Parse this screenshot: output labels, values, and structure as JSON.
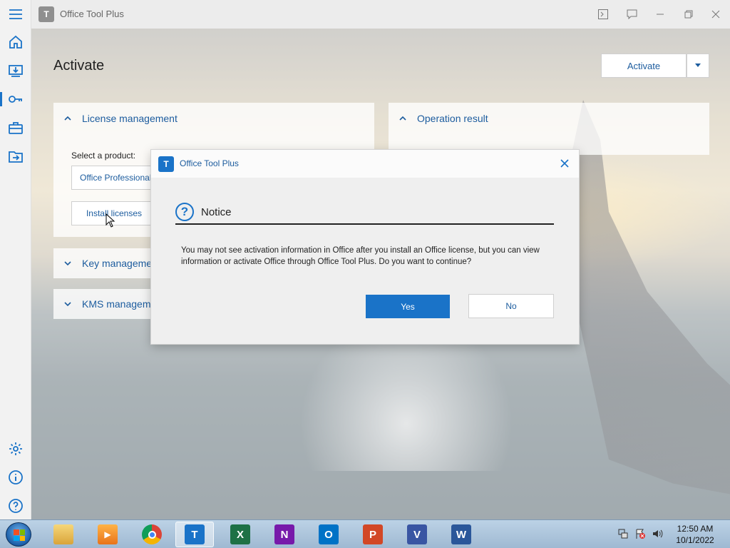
{
  "window": {
    "title": "Office Tool Plus"
  },
  "sidebar": {
    "items": [
      {
        "name": "home",
        "icon": "home-icon"
      },
      {
        "name": "deploy",
        "icon": "download-monitor-icon"
      },
      {
        "name": "activate",
        "icon": "key-icon",
        "active": true
      },
      {
        "name": "toolbox",
        "icon": "toolbox-icon"
      },
      {
        "name": "convert",
        "icon": "folder-arrow-icon"
      },
      {
        "name": "settings",
        "icon": "gear-icon"
      },
      {
        "name": "about",
        "icon": "info-icon"
      },
      {
        "name": "help",
        "icon": "help-icon"
      }
    ]
  },
  "page": {
    "title": "Activate",
    "activate_button": "Activate"
  },
  "cards": {
    "license": {
      "title": "License management",
      "select_label": "Select a product:",
      "select_value": "Office Professional",
      "install_button": "Install licenses"
    },
    "key": {
      "title": "Key manageme"
    },
    "kms": {
      "title": "KMS manageme"
    },
    "result": {
      "title": "Operation result"
    }
  },
  "dialog": {
    "title": "Office Tool Plus",
    "heading": "Notice",
    "message": "You may not see activation information in Office after you install an Office license, but you can view information or activate Office through Office Tool Plus. Do you want to continue?",
    "yes_label": "Yes",
    "no_label": "No"
  },
  "taskbar": {
    "apps": [
      {
        "name": "file-explorer",
        "letter": "",
        "color": "#e8b84a"
      },
      {
        "name": "media-player",
        "letter": "",
        "color": "#f08a24"
      },
      {
        "name": "chrome",
        "letter": "",
        "color": "#4285f4"
      },
      {
        "name": "office-tool-plus",
        "letter": "T",
        "color": "#1a73c8",
        "active": true
      },
      {
        "name": "excel",
        "letter": "X",
        "color": "#1e7145"
      },
      {
        "name": "onenote",
        "letter": "N",
        "color": "#7719aa"
      },
      {
        "name": "outlook",
        "letter": "O",
        "color": "#0072c6"
      },
      {
        "name": "powerpoint",
        "letter": "P",
        "color": "#d24726"
      },
      {
        "name": "visio",
        "letter": "V",
        "color": "#3955a3"
      },
      {
        "name": "word",
        "letter": "W",
        "color": "#2b579a"
      }
    ],
    "time": "12:50 AM",
    "date": "10/1/2022"
  },
  "colors": {
    "accent": "#1a73c8",
    "link_text": "#1c5c9e"
  }
}
